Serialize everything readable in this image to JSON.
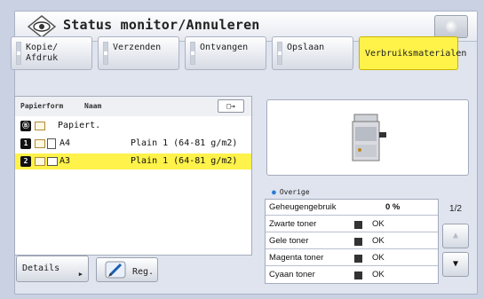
{
  "title": "Status monitor/Annuleren",
  "tabs": [
    {
      "label": "Kopie/\nAfdruk",
      "active": false
    },
    {
      "label": "Verzenden",
      "active": false
    },
    {
      "label": "Ontvangen",
      "active": false
    },
    {
      "label": "Opslaan",
      "active": false
    },
    {
      "label": "Verbruiksmaterialen",
      "active": true
    }
  ],
  "paper_list": {
    "header_source": "Papierform",
    "header_name": "Naam",
    "rows": [
      {
        "badge": "Ⓑ",
        "size": "",
        "name": "Papiert.",
        "selected": false
      },
      {
        "badge": "1",
        "size": "A4",
        "name": "Plain 1 (64-81 g/m2)",
        "selected": false
      },
      {
        "badge": "2",
        "size": "A3",
        "name": "Plain 1 (64-81 g/m2)",
        "selected": true
      }
    ]
  },
  "buttons": {
    "details": "Details",
    "reg": "Reg."
  },
  "overige": "Overige",
  "status_table": [
    {
      "label": "Geheugengebruik",
      "value": "0 %"
    },
    {
      "label": "Zwarte toner",
      "value": "OK"
    },
    {
      "label": "Gele toner",
      "value": "OK"
    },
    {
      "label": "Magenta toner",
      "value": "OK"
    },
    {
      "label": "Cyaan toner",
      "value": "OK"
    }
  ],
  "pager": {
    "page": "1/2"
  },
  "colors": {
    "accent": "#fff34a",
    "background": "#c9d1e3"
  }
}
